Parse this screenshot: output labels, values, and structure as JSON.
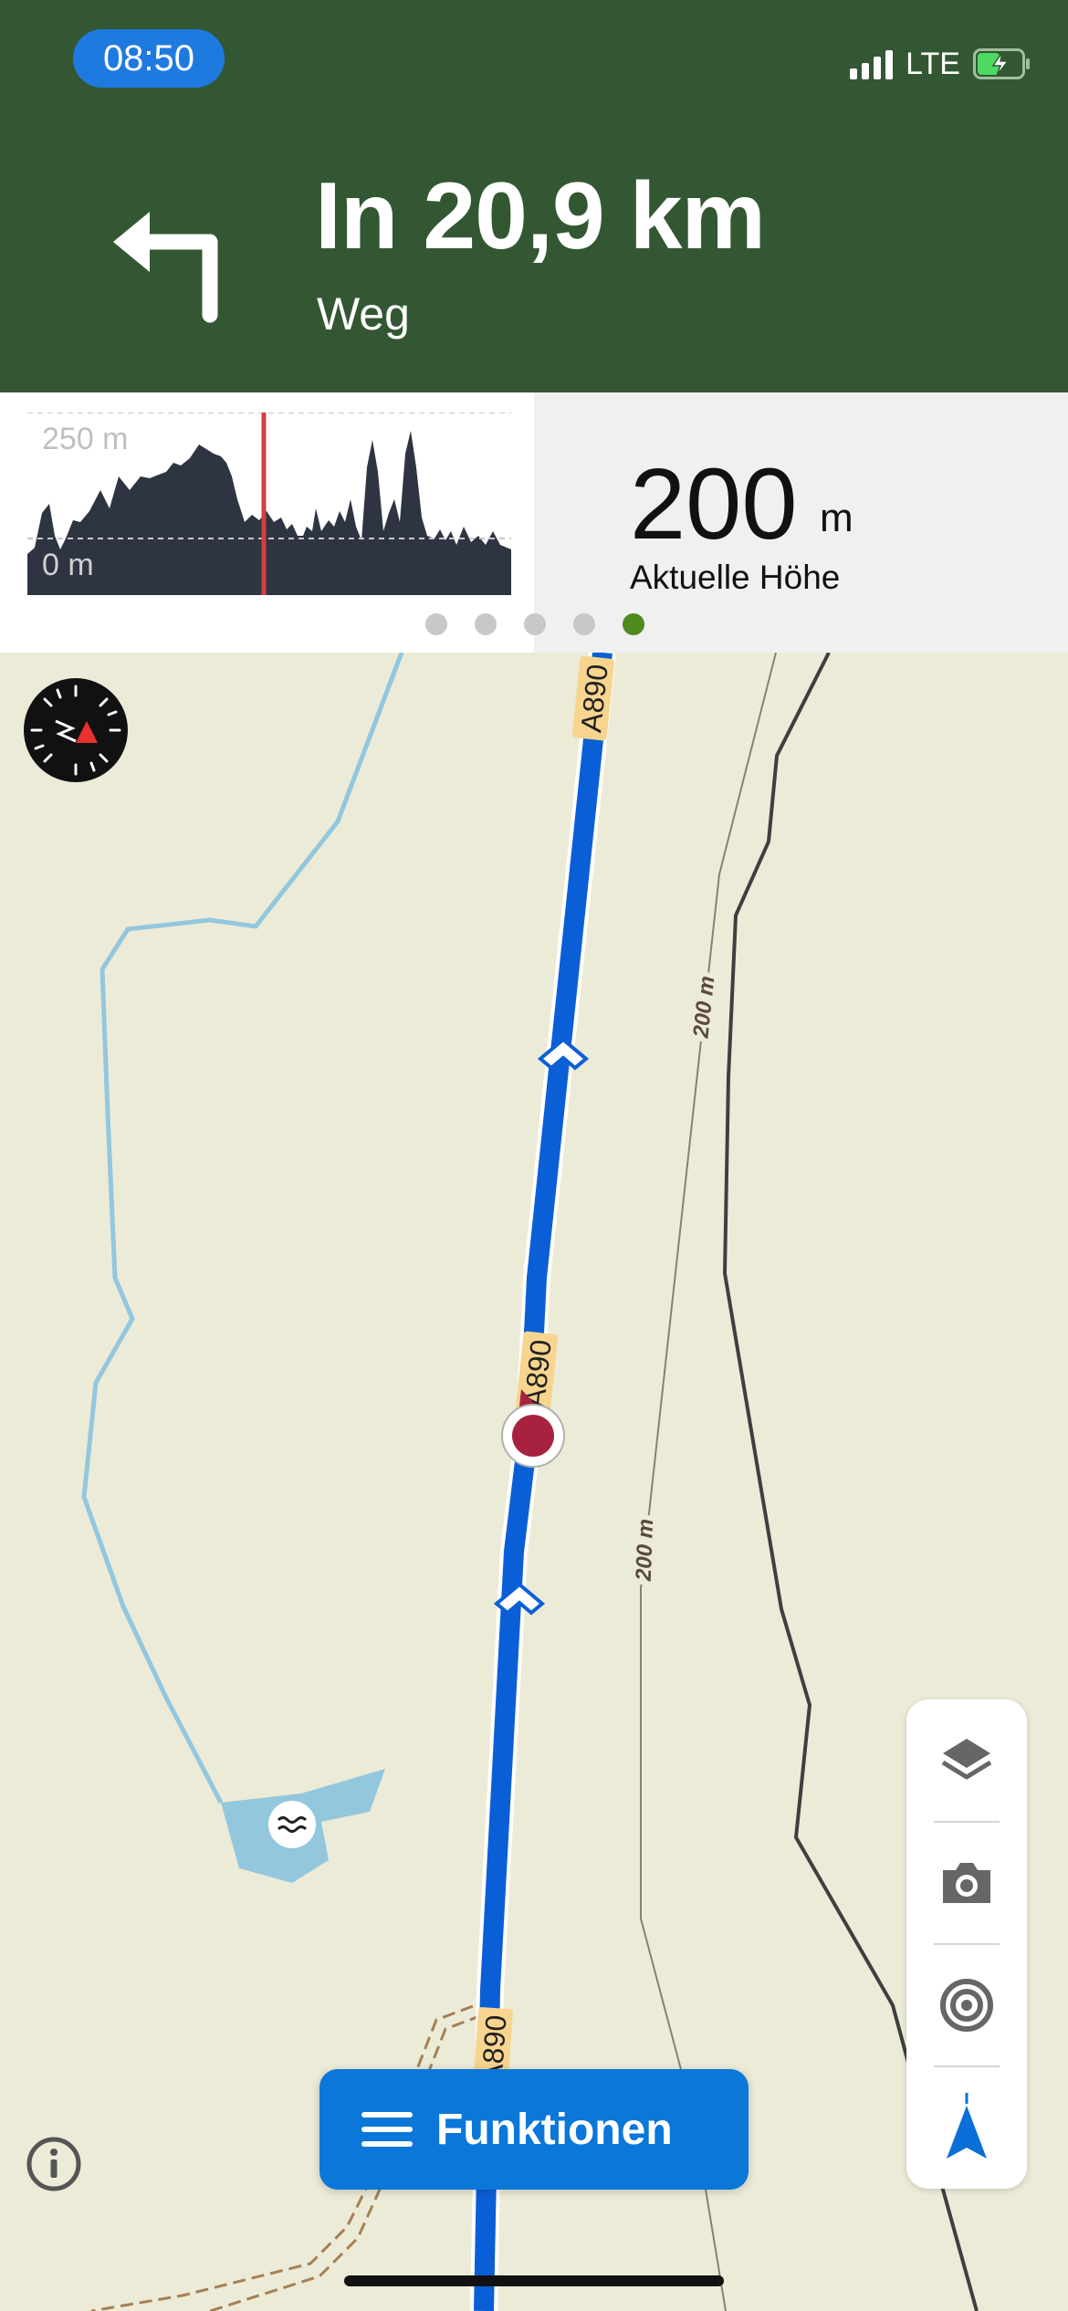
{
  "status_bar": {
    "time": "08:50",
    "network": "LTE"
  },
  "navigation": {
    "distance": "In 20,9 km",
    "street": "Weg",
    "turn_icon": "turn-left-arrow-icon"
  },
  "elevation": {
    "max_label": "250 m",
    "min_label": "0 m",
    "current_value": "200",
    "current_unit": "m",
    "current_label": "Aktuelle Höhe"
  },
  "pager": {
    "count": 5,
    "active_index": 4
  },
  "map": {
    "road_labels": [
      "A890",
      "A890",
      "A890"
    ],
    "contour_labels": [
      "200 m",
      "200 m"
    ],
    "colors": {
      "route": "#0b5fd6",
      "water": "#93c7de",
      "land": "#ecebd8",
      "position": "#a8223f",
      "header": "#335733"
    }
  },
  "toolbar": {
    "icons": [
      "layers-icon",
      "camera-icon",
      "radar-icon",
      "navigation-arrow-icon"
    ]
  },
  "functions_button": {
    "label": "Funktionen"
  }
}
